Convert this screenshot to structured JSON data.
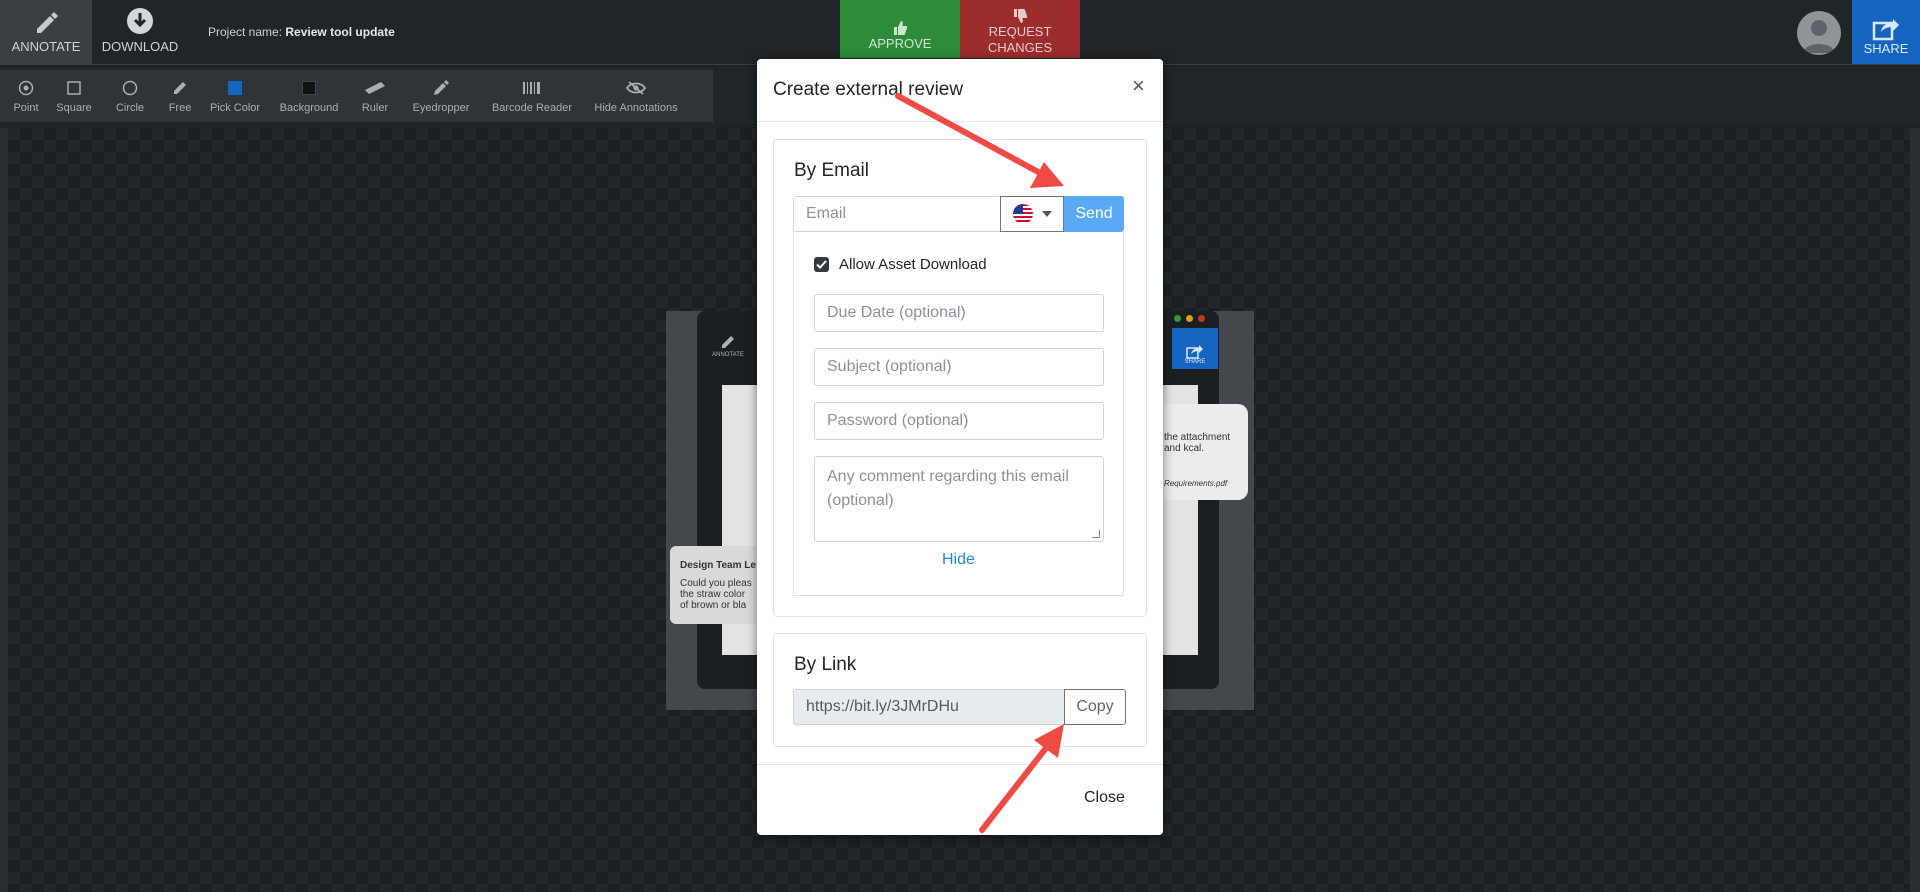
{
  "topbar": {
    "annotate_label": "ANNOTATE",
    "download_label": "DOWNLOAD",
    "project_prefix": "Project name:",
    "project_name": "Review tool update",
    "approve_label": "APPROVE",
    "request_changes_label": "REQUEST CHANGES",
    "share_label": "SHARE"
  },
  "tools": [
    {
      "label": "Point",
      "icon": "point-icon"
    },
    {
      "label": "Square",
      "icon": "square-icon"
    },
    {
      "label": "Circle",
      "icon": "circle-icon"
    },
    {
      "label": "Free",
      "icon": "pencil-icon"
    },
    {
      "label": "Pick Color",
      "icon": "color-swatch-icon"
    },
    {
      "label": "Background",
      "icon": "background-swatch-icon"
    },
    {
      "label": "Ruler",
      "icon": "ruler-icon"
    },
    {
      "label": "Eyedropper",
      "icon": "eyedropper-icon"
    },
    {
      "label": "Barcode Reader",
      "icon": "barcode-icon"
    },
    {
      "label": "Hide Annotations",
      "icon": "eye-slash-icon"
    }
  ],
  "colors": {
    "approve": "#2e8b3a",
    "request_changes": "#9b2d2d",
    "share": "#1565c0",
    "pick_color": "#1565c0",
    "background_color": "#111111",
    "send": "#5aa9f5",
    "link": "#1e88e5",
    "arrow": "#ef4a44"
  },
  "preview": {
    "annotate_label": "ANNOTATE",
    "share_label": "SHARE",
    "right_bubble_text": "the attachment and kcal.",
    "right_bubble_file": "Requirements.pdf",
    "left_bubble_title": "Design Team Le",
    "left_bubble_text": "Could you pleas the straw color of brown or bla"
  },
  "modal": {
    "title": "Create external review",
    "close_x": "×",
    "by_email": {
      "heading": "By Email",
      "email_placeholder": "Email",
      "send_label": "Send",
      "allow_download_label": "Allow Asset Download",
      "allow_download_checked": true,
      "due_date_placeholder": "Due Date (optional)",
      "subject_placeholder": "Subject (optional)",
      "password_placeholder": "Password (optional)",
      "comment_placeholder": "Any comment regarding this email (optional)",
      "hide_label": "Hide"
    },
    "by_link": {
      "heading": "By Link",
      "url": "https://bit.ly/3JMrDHu",
      "copy_label": "Copy"
    },
    "close_label": "Close"
  }
}
